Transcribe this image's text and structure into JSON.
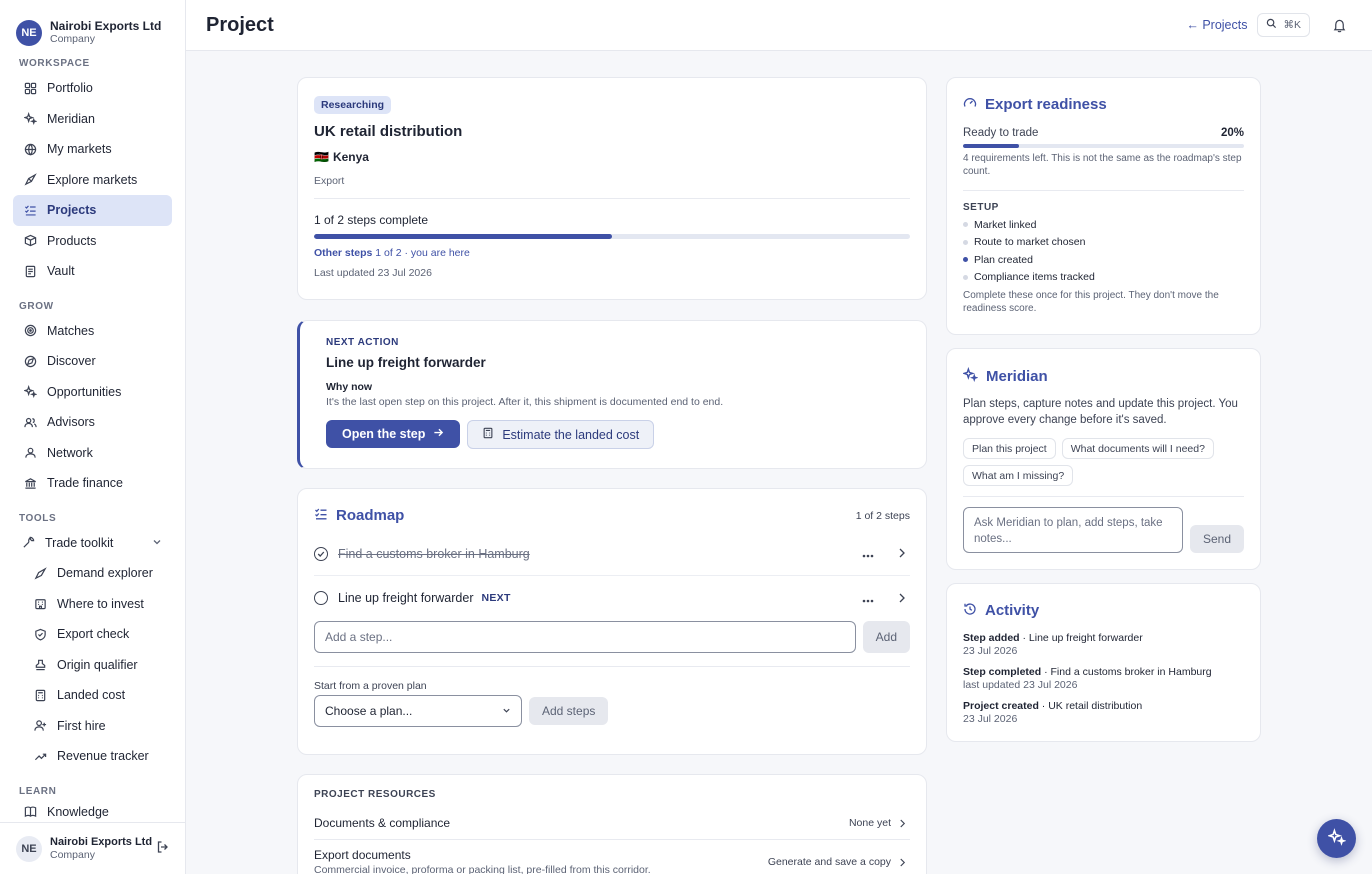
{
  "org": {
    "initials": "NE",
    "name": "Nairobi Exports Ltd",
    "type": "Company"
  },
  "sidebar": {
    "workspace_label": "WORKSPACE",
    "workspace": [
      {
        "label": "Portfolio",
        "icon": "grid-icon"
      },
      {
        "label": "Meridian",
        "icon": "sparkle-icon"
      },
      {
        "label": "My markets",
        "icon": "globe-icon"
      },
      {
        "label": "Explore markets",
        "icon": "compass-icon"
      },
      {
        "label": "Projects",
        "icon": "checklist-icon",
        "active": true
      },
      {
        "label": "Products",
        "icon": "box-icon"
      },
      {
        "label": "Vault",
        "icon": "file-icon"
      }
    ],
    "grow_label": "GROW",
    "grow": [
      {
        "label": "Matches",
        "icon": "target-icon"
      },
      {
        "label": "Discover",
        "icon": "discover-icon"
      },
      {
        "label": "Opportunities",
        "icon": "sparkle-icon"
      },
      {
        "label": "Advisors",
        "icon": "users-icon"
      },
      {
        "label": "Network",
        "icon": "network-icon"
      },
      {
        "label": "Trade finance",
        "icon": "bank-icon"
      }
    ],
    "tools_label": "TOOLS",
    "toolkit": {
      "label": "Trade toolkit",
      "icon": "wrench-icon"
    },
    "tools": [
      {
        "label": "Demand explorer",
        "icon": "rocket-icon"
      },
      {
        "label": "Where to invest",
        "icon": "building-icon"
      },
      {
        "label": "Export check",
        "icon": "shield-icon"
      },
      {
        "label": "Origin qualifier",
        "icon": "stamp-icon"
      },
      {
        "label": "Landed cost",
        "icon": "calculator-icon"
      },
      {
        "label": "First hire",
        "icon": "user-plus-icon"
      },
      {
        "label": "Revenue tracker",
        "icon": "trend-icon"
      }
    ],
    "learn_label": "LEARN",
    "learn": [
      {
        "label": "Knowledge",
        "icon": "book-icon"
      }
    ]
  },
  "header": {
    "title": "Project",
    "back_label": "← Projects",
    "shortcut": "⌘K"
  },
  "project": {
    "status": "Researching",
    "name": "UK retail distribution",
    "flag": "🇰🇪",
    "country": "Kenya",
    "direction": "Export",
    "steps_complete": "1 of 2 steps complete",
    "progress": 0.5,
    "other_steps_label": "Other steps",
    "other_steps_detail": "1 of 2 · you are here",
    "last_updated": "Last updated 23 Jul 2026"
  },
  "next_action": {
    "label": "NEXT ACTION",
    "title": "Line up freight forwarder",
    "why_label": "Why now",
    "why_text": "It's the last open step on this project. After it, this shipment is documented end to end.",
    "primary": "Open the step",
    "secondary": "Estimate the landed cost"
  },
  "roadmap": {
    "title": "Roadmap",
    "count": "1 of 2 steps",
    "steps": [
      {
        "label": "Find a customs broker in Hamburg",
        "done": true
      },
      {
        "label": "Line up freight forwarder",
        "done": false,
        "tag": "NEXT"
      }
    ],
    "add_placeholder": "Add a step...",
    "add_button": "Add",
    "plan_label": "Start from a proven plan",
    "plan_placeholder": "Choose a plan...",
    "plan_button": "Add steps"
  },
  "resources": {
    "label": "PROJECT RESOURCES",
    "items": [
      {
        "title": "Documents & compliance",
        "right": "None yet"
      },
      {
        "title": "Export documents",
        "sub": "Commercial invoice, proforma or packing list, pre-filled from this corridor.",
        "right": "Generate and save a copy"
      }
    ]
  },
  "readiness": {
    "title": "Export readiness",
    "label": "Ready to trade",
    "percent": "20%",
    "value": 0.2,
    "note": "4 requirements left. This is not the same as the roadmap's step count.",
    "setup_label": "SETUP",
    "setup": [
      {
        "label": "Market linked",
        "done": false
      },
      {
        "label": "Route to market chosen",
        "done": false
      },
      {
        "label": "Plan created",
        "done": true
      },
      {
        "label": "Compliance items tracked",
        "done": false
      }
    ],
    "footer": "Complete these once for this project. They don't move the readiness score."
  },
  "meridian": {
    "title": "Meridian",
    "desc": "Plan steps, capture notes and update this project. You approve every change before it's saved.",
    "chips": [
      "Plan this project",
      "What documents will I need?",
      "What am I missing?"
    ],
    "placeholder": "Ask Meridian to plan, add steps, take notes...",
    "send": "Send"
  },
  "activity": {
    "title": "Activity",
    "items": [
      {
        "kind": "Step added",
        "detail": " · Line up freight forwarder",
        "date": "23 Jul 2026"
      },
      {
        "kind": "Step completed",
        "detail": " · Find a customs broker in Hamburg",
        "date": "last updated 23 Jul 2026"
      },
      {
        "kind": "Project created",
        "detail": " · UK retail distribution",
        "date": "23 Jul 2026"
      }
    ]
  },
  "colors": {
    "accent": "#3f51a6",
    "accent_soft": "#dde4f7",
    "background": "#f6f7fa"
  }
}
